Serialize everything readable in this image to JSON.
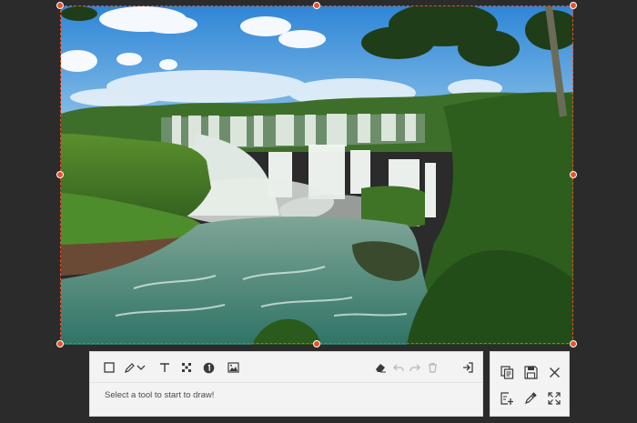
{
  "capture": {
    "subject": "waterfall landscape screenshot region"
  },
  "toolbar": {
    "tools": [
      {
        "name": "rectangle-tool",
        "icon": "rectangle-icon"
      },
      {
        "name": "pen-tool",
        "icon": "pen-icon"
      },
      {
        "name": "pen-options-dropdown",
        "icon": "chevron-down-icon"
      },
      {
        "name": "text-tool",
        "icon": "text-icon"
      },
      {
        "name": "mosaic-tool",
        "icon": "mosaic-icon"
      },
      {
        "name": "step-number-tool",
        "icon": "step-number-icon"
      },
      {
        "name": "image-tool",
        "icon": "image-icon"
      }
    ],
    "actions": [
      {
        "name": "eraser-button",
        "icon": "eraser-icon",
        "enabled": true
      },
      {
        "name": "undo-button",
        "icon": "undo-icon",
        "enabled": false
      },
      {
        "name": "redo-button",
        "icon": "redo-icon",
        "enabled": false
      },
      {
        "name": "delete-button",
        "icon": "trash-icon",
        "enabled": false
      },
      {
        "name": "exit-button",
        "icon": "exit-icon",
        "enabled": true
      }
    ],
    "hint_text": "Select a tool to start to draw!"
  },
  "side_panel": {
    "actions": [
      {
        "name": "copy-button",
        "icon": "copy-icon"
      },
      {
        "name": "save-button",
        "icon": "save-icon"
      },
      {
        "name": "close-button",
        "icon": "close-icon"
      },
      {
        "name": "pin-to-screen-button",
        "icon": "pin-image-icon"
      },
      {
        "name": "color-picker-button",
        "icon": "eyedropper-icon"
      },
      {
        "name": "fullscreen-button",
        "icon": "expand-icon"
      }
    ]
  },
  "colors": {
    "background": "#2b2b2b",
    "selection_accent": "#e8502a",
    "toolbar_bg": "#f3f3f3",
    "icon": "#3a3a3a",
    "icon_disabled": "#b9b9b9"
  }
}
